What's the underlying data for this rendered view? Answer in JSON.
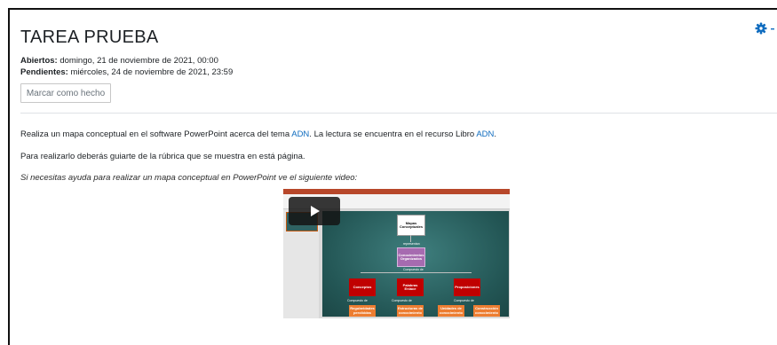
{
  "page": {
    "title": "TAREA PRUEBA"
  },
  "dates": {
    "opened_label": "Abiertos:",
    "opened_value": " domingo, 21 de noviembre de 2021, 00:00",
    "due_label": "Pendientes:",
    "due_value": " miércoles, 24 de noviembre de 2021, 23:59"
  },
  "actions": {
    "mark_done_label": "Marcar como hecho",
    "settings_icon": "gear-icon"
  },
  "content": {
    "p1_before": "Realiza un mapa conceptual en el software PowerPoint acerca del tema ",
    "p1_link1": "ADN",
    "p1_middle": ". La lectura se encuentra en el recurso Libro ",
    "p1_link2": "ADN",
    "p1_end": ".",
    "p2": "Para realizarlo deberás guiarte de la rúbrica que se muestra en está página.",
    "p3": "Si necesitas ayuda para realizar un mapa conceptual en PowerPoint ve el siguiente video:"
  },
  "video": {
    "play_icon": "play-icon",
    "slide": {
      "title": "Mapas Conceptuales",
      "level1": "Conocimientos Organizados",
      "level2": [
        "Conceptos",
        "Palabras Enlace",
        "Proposiciones"
      ],
      "level3": [
        "Regularidades percibidas",
        "Estructuras de conocimiento",
        "Unidades de conocimiento",
        "Construcción conocimiento"
      ],
      "link_labels": [
        "representan",
        "Compuesto de",
        "Compuesto de",
        "Compuesto de",
        "Compuesto de"
      ]
    }
  },
  "colors": {
    "link": "#0f6cbf",
    "gear": "#0f6cbf"
  }
}
